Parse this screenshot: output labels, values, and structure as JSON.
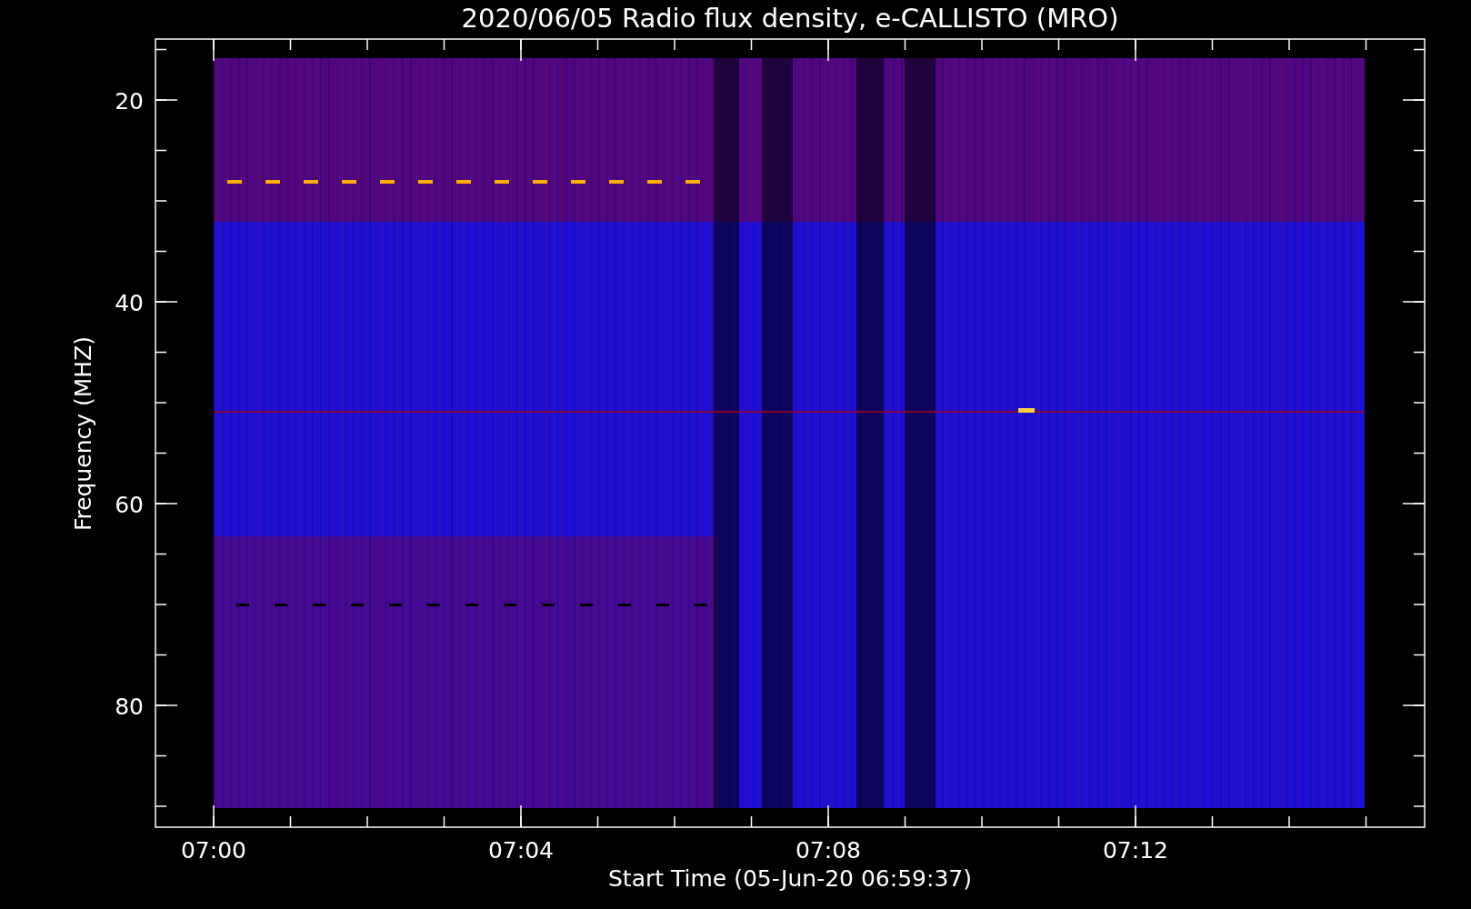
{
  "title": "2020/06/05  Radio flux density, e-CALLISTO (MRO)",
  "y_axis": {
    "label": "Frequency (MHZ)",
    "ticks": [
      "20",
      "40",
      "60",
      "80"
    ]
  },
  "x_axis": {
    "label": "Start Time (05-Jun-20 06:59:37)",
    "ticks": [
      "07:00",
      "07:04",
      "07:08",
      "07:12"
    ]
  }
}
